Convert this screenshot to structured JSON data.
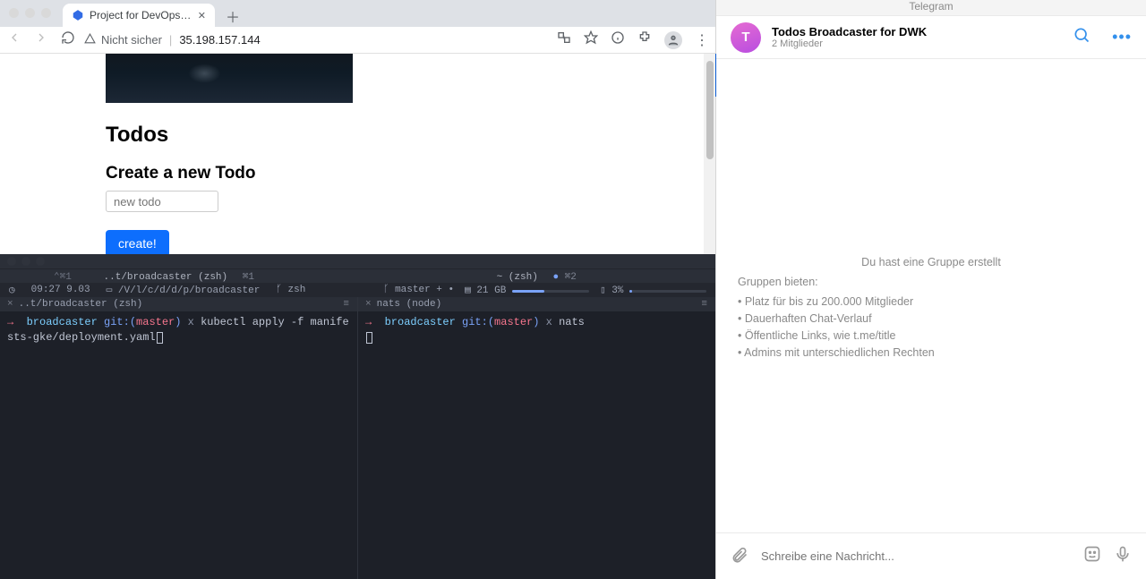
{
  "browser": {
    "tab": {
      "title": "Project for DevOps with Kuber"
    },
    "security_label": "Nicht sicher",
    "url": "35.198.157.144"
  },
  "page": {
    "h1": "Todos",
    "h2": "Create a new Todo",
    "input_placeholder": "new todo",
    "create_label": "create!"
  },
  "terminal": {
    "tabs": {
      "left": {
        "label": "..t/broadcaster (zsh)",
        "shortcut_left": "⌃⌘1",
        "shortcut": "⌘1"
      },
      "right": {
        "label": "~ (zsh)",
        "shortcut": "⌘2",
        "dot_color": "#7aa2f7"
      }
    },
    "status": {
      "time": "09:27 9.03",
      "path": "/V/l/c/d/d/p/broadcaster",
      "shell": "zsh",
      "branch": "master + •",
      "disk": "21 GB",
      "battery": "3%"
    },
    "panes": {
      "left": {
        "title": "..t/broadcaster (zsh)",
        "prompt_project": "broadcaster",
        "prompt_git": "git:",
        "prompt_branch": "master",
        "marker": "x",
        "cmd": "kubectl apply -f manifests-gke/deployment.yaml"
      },
      "right": {
        "title": "nats (node)",
        "prompt_project": "broadcaster",
        "prompt_git": "git:",
        "prompt_branch": "master",
        "marker": "x",
        "cmd": "nats"
      }
    }
  },
  "telegram": {
    "app_title": "Telegram",
    "avatar_initial": "T",
    "chat_name": "Todos Broadcaster for DWK",
    "chat_sub": "2 Mitglieder",
    "created_line": "Du hast eine Gruppe erstellt",
    "lead": "Gruppen bieten:",
    "bullets": [
      "• Platz für bis zu 200.000 Mitglieder",
      "• Dauerhaften Chat-Verlauf",
      "• Öffentliche Links, wie t.me/title",
      "• Admins mit unterschiedlichen Rechten"
    ],
    "compose_placeholder": "Schreibe eine Nachricht..."
  }
}
